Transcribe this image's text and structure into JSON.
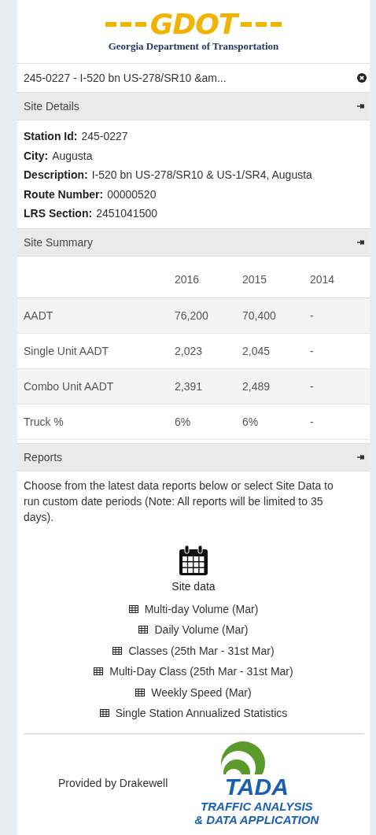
{
  "header": {
    "logo_mark": "GDOT",
    "logo_caption": "Georgia Department of Transportation"
  },
  "site_title": "245-0227 - I-520 bn US-278/SR10 &am...",
  "site_details": {
    "title": "Site Details",
    "fields": [
      {
        "label": "Station Id:",
        "value": "245-0227"
      },
      {
        "label": "City:",
        "value": "Augusta"
      },
      {
        "label": "Description:",
        "value": "I-520 bn US-278/SR10 & US-1/SR4, Augusta"
      },
      {
        "label": "Route Number:",
        "value": "00000520"
      },
      {
        "label": "LRS Section:",
        "value": "2451041500"
      }
    ]
  },
  "site_summary": {
    "title": "Site Summary",
    "columns": [
      "2016",
      "2015",
      "2014"
    ],
    "rows": [
      {
        "label": "AADT",
        "values": [
          "76,200",
          "70,400",
          "-"
        ]
      },
      {
        "label": "Single Unit AADT",
        "values": [
          "2,023",
          "2,045",
          "-"
        ]
      },
      {
        "label": "Combo Unit AADT",
        "values": [
          "2,391",
          "2,489",
          "-"
        ]
      },
      {
        "label": "Truck %",
        "values": [
          "6%",
          "6%",
          "-"
        ]
      }
    ]
  },
  "reports": {
    "title": "Reports",
    "intro": "Choose from the latest data reports below or select Site Data to run custom date periods (Note: All reports will be limited to 35 days).",
    "site_data_label": "Site data",
    "links": [
      "Multi-day Volume (Mar)",
      "Daily Volume (Mar)",
      "Classes (25th Mar - 31st Mar)",
      "Multi-Day Class (25th Mar - 31st Mar)",
      "Weekly Speed (Mar)",
      "Single Station Annualized Statistics"
    ]
  },
  "footer": {
    "provided_by": "Provided by Drakewell",
    "logo_word": "TADA",
    "logo_caption_1": "TRAFFIC ANALYSIS",
    "logo_caption_2": "& DATA APPLICATION"
  }
}
